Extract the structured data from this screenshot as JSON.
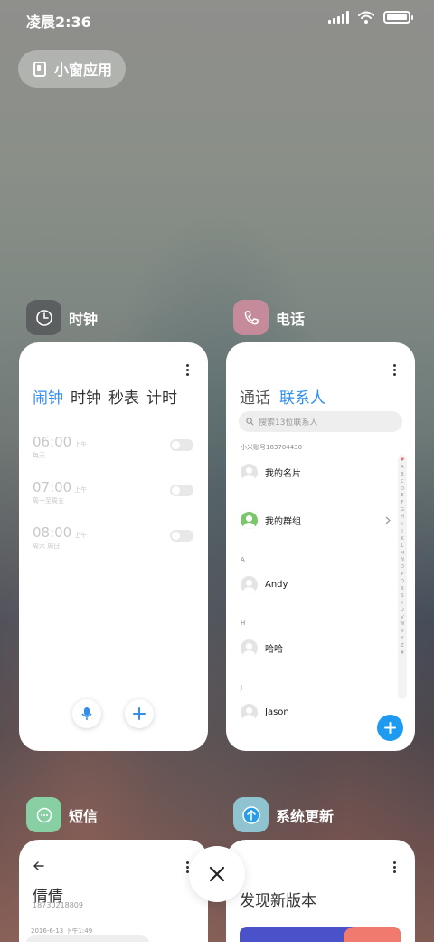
{
  "status": {
    "time": "凌晨2:36"
  },
  "floating": {
    "label": "小窗应用"
  },
  "clock": {
    "title": "时钟",
    "tabs": [
      "闹钟",
      "时钟",
      "秒表",
      "计时"
    ],
    "alarms": [
      {
        "time": "06:00",
        "ampm": "上午",
        "repeat": "每天",
        "enabled": false
      },
      {
        "time": "07:00",
        "ampm": "上午",
        "repeat": "周一至周五",
        "enabled": false
      },
      {
        "time": "08:00",
        "ampm": "上午",
        "repeat": "周六 周日",
        "enabled": false
      }
    ]
  },
  "phone": {
    "title": "电话",
    "tabs": [
      "通话",
      "联系人"
    ],
    "search_placeholder": "搜索13位联系人",
    "account": "小米账号183704430",
    "contacts": [
      {
        "name": "我的名片"
      },
      {
        "name": "我的群组"
      }
    ],
    "sections": [
      {
        "letter": "A",
        "name": "Andy"
      },
      {
        "letter": "H",
        "name": "哈哈"
      },
      {
        "letter": "J",
        "name": "Jason"
      }
    ],
    "index": [
      "♥",
      "A",
      "B",
      "C",
      "D",
      "E",
      "F",
      "G",
      "H",
      "I",
      "J",
      "K",
      "L",
      "M",
      "N",
      "O",
      "P",
      "Q",
      "R",
      "S",
      "T",
      "U",
      "V",
      "W",
      "X",
      "Y",
      "Z",
      "#"
    ]
  },
  "sms": {
    "title": "短信",
    "contact_name": "倩倩",
    "contact_number": "18730218809",
    "date": "2016-6-13 下午1:49"
  },
  "update": {
    "title": "系统更新",
    "headline": "发现新版本"
  },
  "colors": {
    "accent": "#2f8eef",
    "fab": "#1e9af1"
  }
}
